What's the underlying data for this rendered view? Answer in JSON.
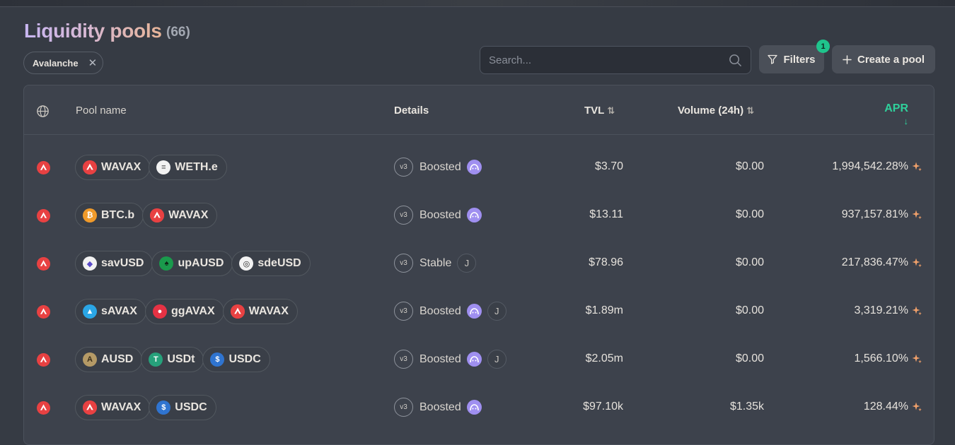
{
  "header": {
    "title": "Liquidity pools",
    "count": "(66)"
  },
  "filter_chip": {
    "label": "Avalanche",
    "remove": "✕"
  },
  "search": {
    "placeholder": "Search..."
  },
  "buttons": {
    "filters": "Filters",
    "filters_badge": "1",
    "create": "Create a pool"
  },
  "table": {
    "headers": {
      "pool_name": "Pool name",
      "details": "Details",
      "tvl": "TVL",
      "volume": "Volume (24h)",
      "apr": "APR"
    },
    "rows": [
      {
        "tokens": [
          {
            "symbol": "WAVAX",
            "icon": "avax"
          },
          {
            "symbol": "WETH.e",
            "icon": "weth"
          }
        ],
        "version": "v3",
        "label": "Boosted",
        "boosted": true,
        "hook": false,
        "tvl": "$3.70",
        "volume": "$0.00",
        "apr": "1,994,542.28%"
      },
      {
        "tokens": [
          {
            "symbol": "BTC.b",
            "icon": "btc"
          },
          {
            "symbol": "WAVAX",
            "icon": "avax"
          }
        ],
        "version": "v3",
        "label": "Boosted",
        "boosted": true,
        "hook": false,
        "tvl": "$13.11",
        "volume": "$0.00",
        "apr": "937,157.81%"
      },
      {
        "tokens": [
          {
            "symbol": "savUSD",
            "icon": "savusd"
          },
          {
            "symbol": "upAUSD",
            "icon": "upausd"
          },
          {
            "symbol": "sdeUSD",
            "icon": "sdeusd"
          }
        ],
        "version": "v3",
        "label": "Stable",
        "boosted": false,
        "hook": true,
        "tvl": "$78.96",
        "volume": "$0.00",
        "apr": "217,836.47%"
      },
      {
        "tokens": [
          {
            "symbol": "sAVAX",
            "icon": "savax"
          },
          {
            "symbol": "ggAVAX",
            "icon": "ggavax"
          },
          {
            "symbol": "WAVAX",
            "icon": "avax"
          }
        ],
        "version": "v3",
        "label": "Boosted",
        "boosted": true,
        "hook": true,
        "tvl": "$1.89m",
        "volume": "$0.00",
        "apr": "3,319.21%"
      },
      {
        "tokens": [
          {
            "symbol": "AUSD",
            "icon": "ausd"
          },
          {
            "symbol": "USDt",
            "icon": "usdt"
          },
          {
            "symbol": "USDC",
            "icon": "usdc"
          }
        ],
        "version": "v3",
        "label": "Boosted",
        "boosted": true,
        "hook": true,
        "tvl": "$2.05m",
        "volume": "$0.00",
        "apr": "1,566.10%"
      },
      {
        "tokens": [
          {
            "symbol": "WAVAX",
            "icon": "avax"
          },
          {
            "symbol": "USDC",
            "icon": "usdc"
          }
        ],
        "version": "v3",
        "label": "Boosted",
        "boosted": true,
        "hook": false,
        "tvl": "$97.10k",
        "volume": "$1.35k",
        "apr": "128.44%"
      }
    ]
  },
  "colors": {
    "accent_green": "#2fd09b",
    "avax_red": "#e84142",
    "boost_purple": "#9f8ff0",
    "spark_orange": "#f0a06a"
  }
}
